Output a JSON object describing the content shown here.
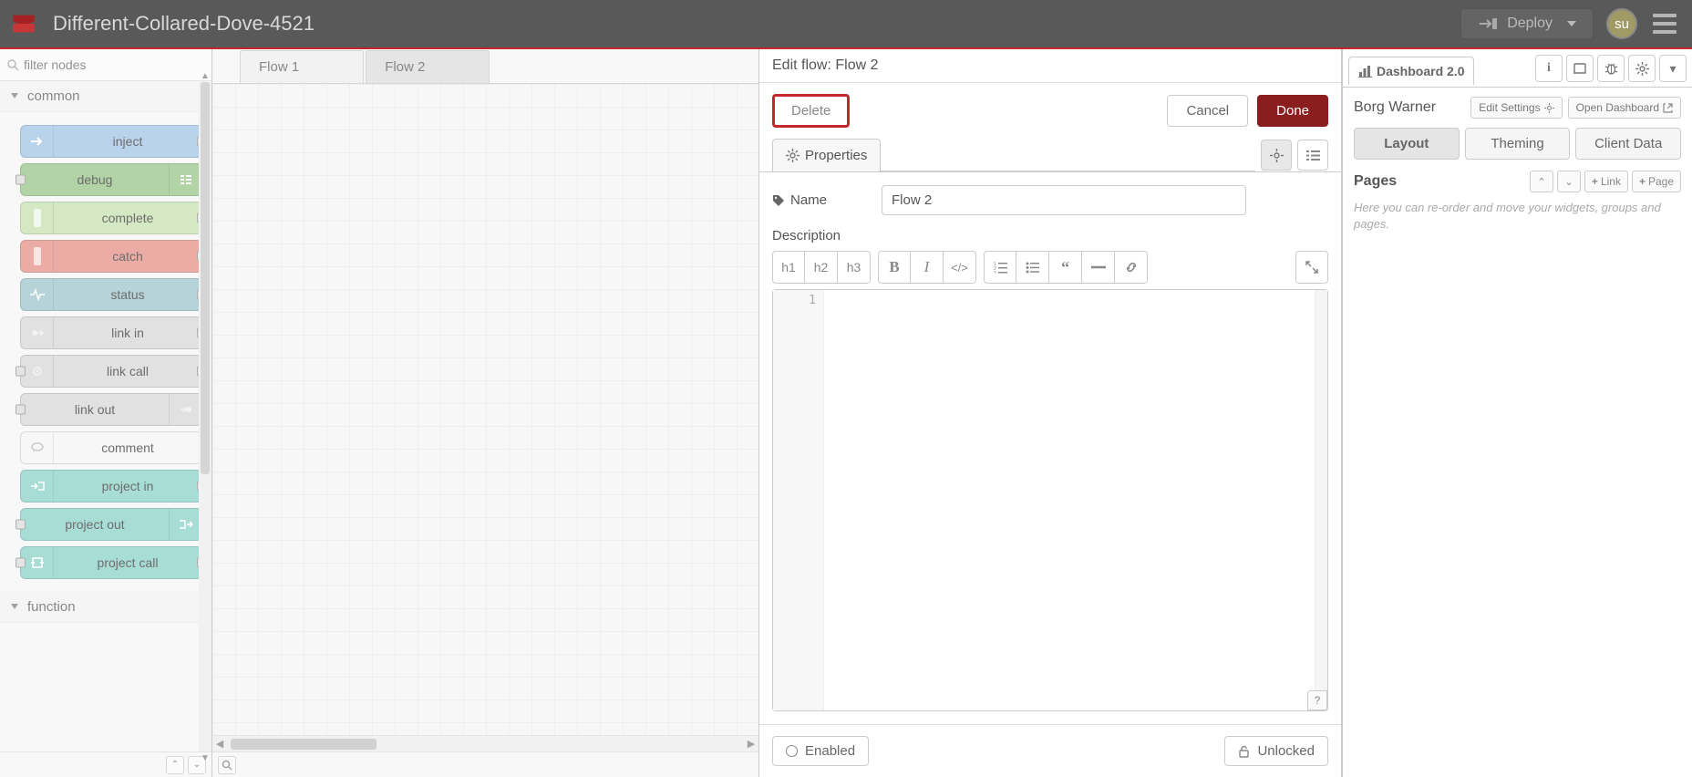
{
  "header": {
    "app_title": "Different-Collared-Dove-4521",
    "deploy": "Deploy",
    "user_initials": "su"
  },
  "palette": {
    "filter_placeholder": "filter nodes",
    "categories": {
      "common": "common",
      "function": "function"
    },
    "nodes": {
      "inject": "inject",
      "debug": "debug",
      "complete": "complete",
      "catch": "catch",
      "status": "status",
      "link_in": "link in",
      "link_call": "link call",
      "link_out": "link out",
      "comment": "comment",
      "project_in": "project in",
      "project_out": "project out",
      "project_call": "project call"
    }
  },
  "tabs": {
    "flow1": "Flow 1",
    "flow2": "Flow 2"
  },
  "tray": {
    "title": "Edit flow: Flow 2",
    "delete": "Delete",
    "cancel": "Cancel",
    "done": "Done",
    "properties": "Properties",
    "name_label": "Name",
    "name_value": "Flow 2",
    "description_label": "Description",
    "toolbar": {
      "h1": "h1",
      "h2": "h2",
      "h3": "h3"
    },
    "editor_line": "1",
    "help": "?",
    "enabled": "Enabled",
    "unlocked": "Unlocked"
  },
  "sidebar": {
    "dashboard_tab": "Dashboard 2.0",
    "dash_title": "Borg Warner",
    "edit_settings": "Edit Settings",
    "open_dashboard": "Open Dashboard",
    "tabs": {
      "layout": "Layout",
      "theming": "Theming",
      "client": "Client Data"
    },
    "pages": "Pages",
    "link_btn": "Link",
    "page_btn": "Page",
    "hint": "Here you can re-order and move your widgets, groups and pages."
  }
}
